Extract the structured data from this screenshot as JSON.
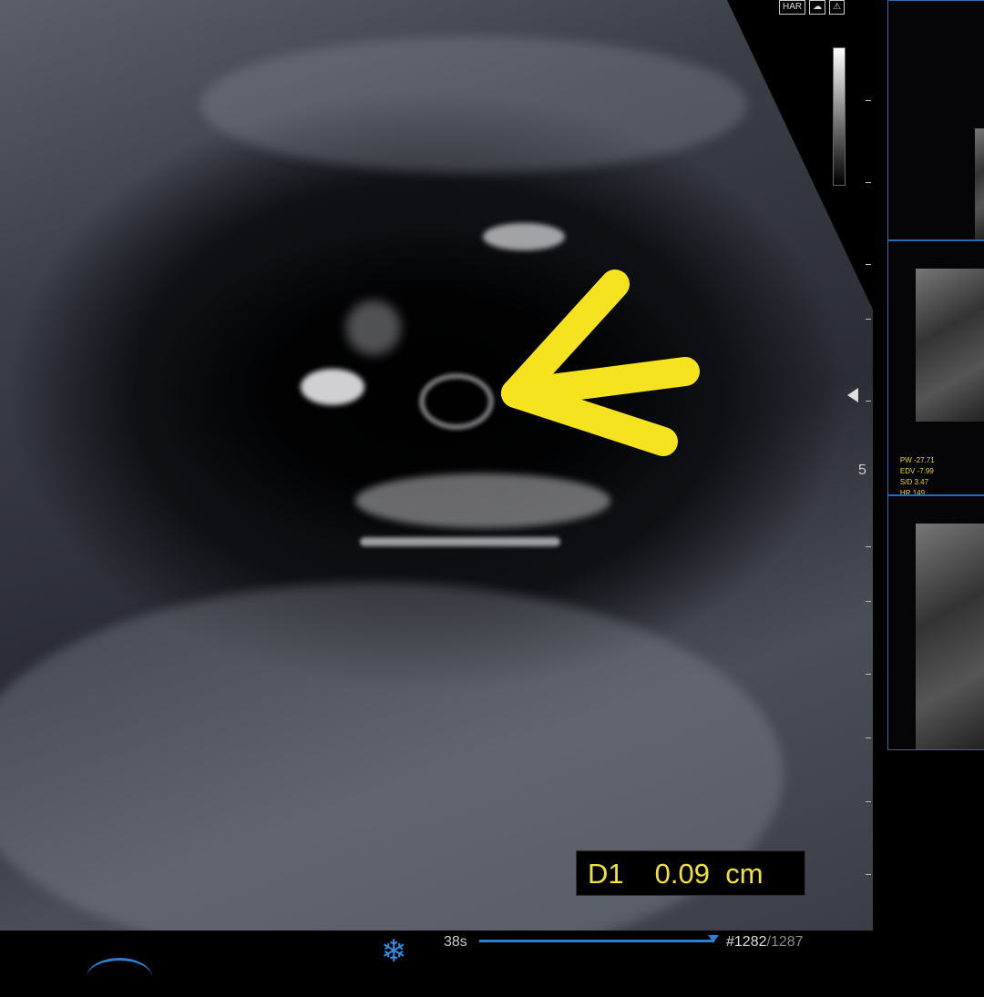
{
  "top_icons": [
    "HAR",
    "probe-icon",
    "warning-icon"
  ],
  "depth_marker": "5",
  "measurement": {
    "label": "D1",
    "value": "0.09",
    "unit": "cm"
  },
  "cine": {
    "time": "38s",
    "frame": "#1282",
    "total": "/1287",
    "progress": 0.996
  },
  "thumbnails": {
    "pw": {
      "rows": [
        {
          "k": "PW",
          "v": "-27.71"
        },
        {
          "k": "EDV",
          "v": "-7.99"
        },
        {
          "k": "S/D",
          "v": "3.47"
        },
        {
          "k": "HR",
          "v": "149"
        }
      ]
    }
  },
  "colors": {
    "accent": "#2f7fd0",
    "measurement": "#f1e236",
    "arrow": "#f5e31f"
  }
}
